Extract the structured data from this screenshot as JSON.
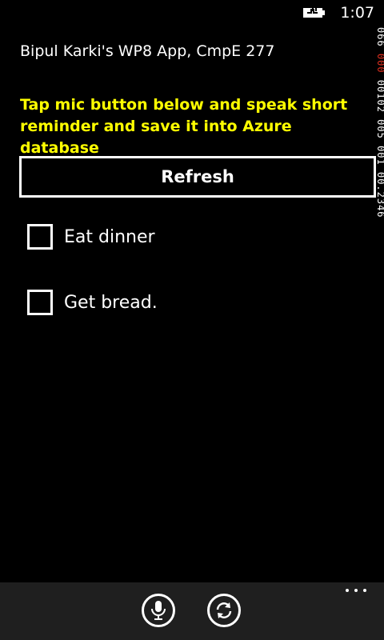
{
  "status_bar": {
    "time": "1:07",
    "battery_icon": "battery-charging-icon"
  },
  "frame_counter": {
    "segments": [
      "066 ",
      "000",
      " 00102 005 001 00.2346"
    ]
  },
  "app": {
    "title": "Bipul Karki's WP8 App, CmpE 277",
    "instructions": "Tap mic button below and speak short reminder and save it  into Azure database",
    "refresh_label": "Refresh",
    "items": [
      {
        "label": "Eat dinner",
        "checked": false
      },
      {
        "label": "Get bread.",
        "checked": false
      }
    ]
  },
  "app_bar": {
    "buttons": [
      {
        "name": "mic-icon"
      },
      {
        "name": "sync-icon"
      }
    ],
    "more_icon": "ellipsis-icon"
  }
}
